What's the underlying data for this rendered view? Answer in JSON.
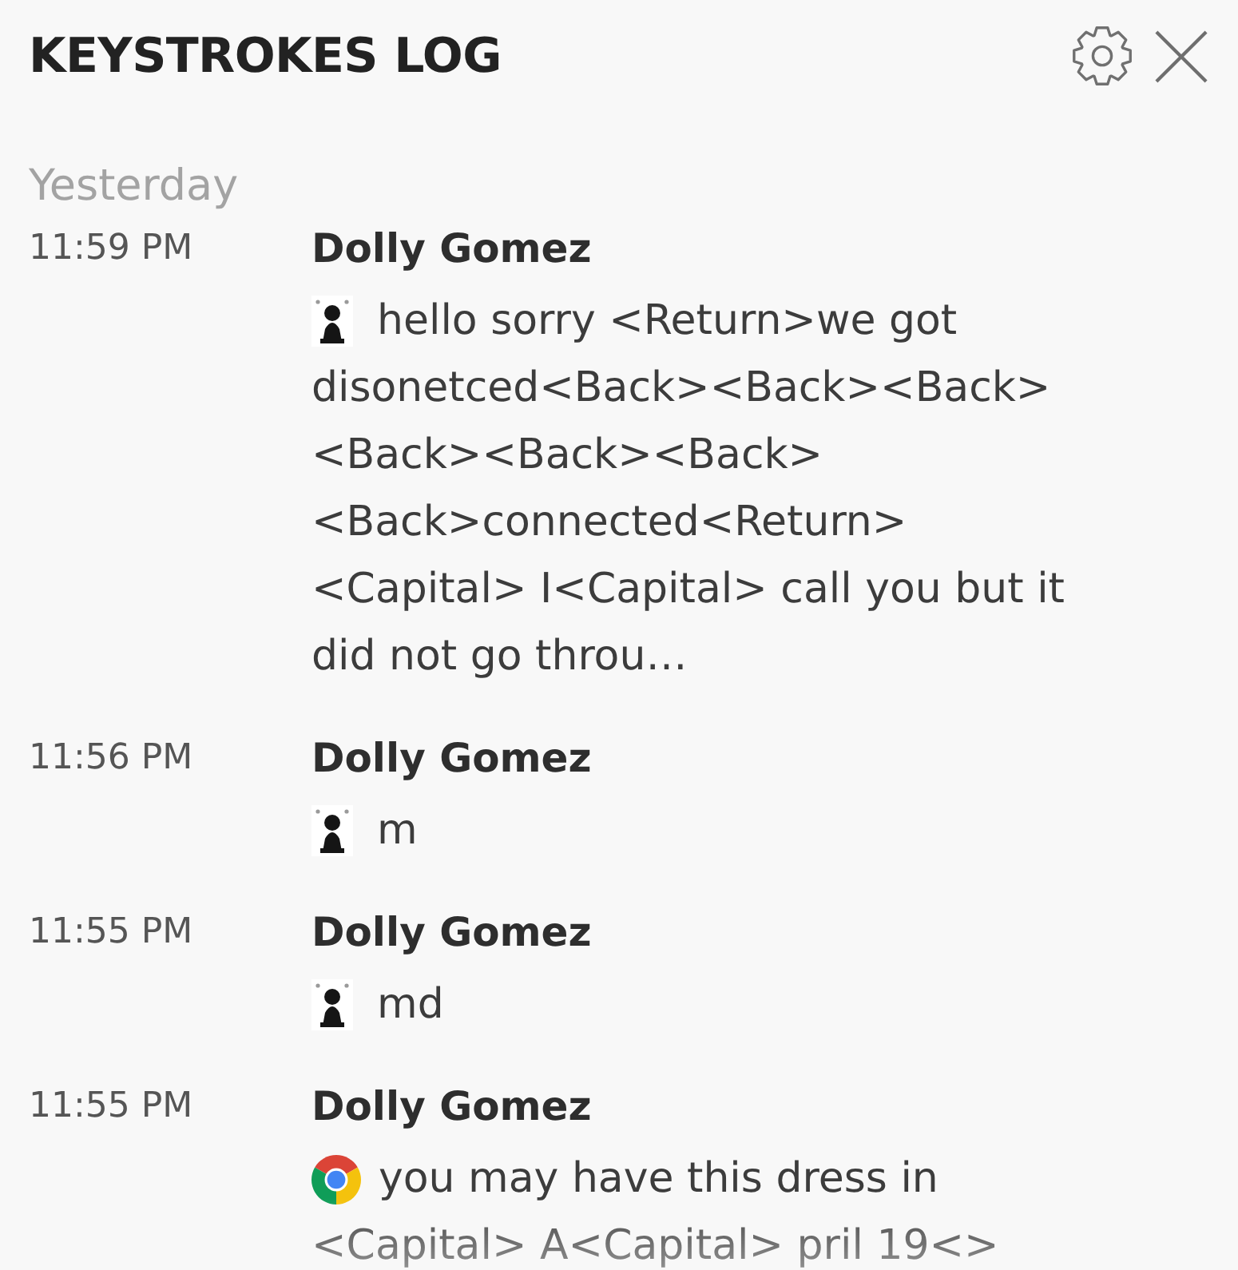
{
  "window": {
    "title": "KEYSTROKES LOG"
  },
  "groups": [
    {
      "date": "Yesterday",
      "entries": [
        {
          "time": "11:59 PM",
          "sender": "Dolly Gomez",
          "kind": "pawn",
          "lines": [
            "hello sorry <Return>we got",
            "disonetced<Back><Back><Back>",
            "<Back><Back><Back>",
            "<Back>connected<Return>",
            "<Capital> I<Capital> call you but it",
            "did not go throu…"
          ]
        },
        {
          "time": "11:56 PM",
          "sender": "Dolly Gomez",
          "kind": "pawn",
          "lines": [
            "m"
          ]
        },
        {
          "time": "11:55 PM",
          "sender": "Dolly Gomez",
          "kind": "pawn",
          "lines": [
            "md"
          ]
        },
        {
          "time": "11:55 PM",
          "sender": "Dolly Gomez",
          "kind": "browser",
          "lines": [
            "you may have this dress in",
            "<Capital> A<Capital> pril 19<>"
          ]
        }
      ]
    }
  ]
}
